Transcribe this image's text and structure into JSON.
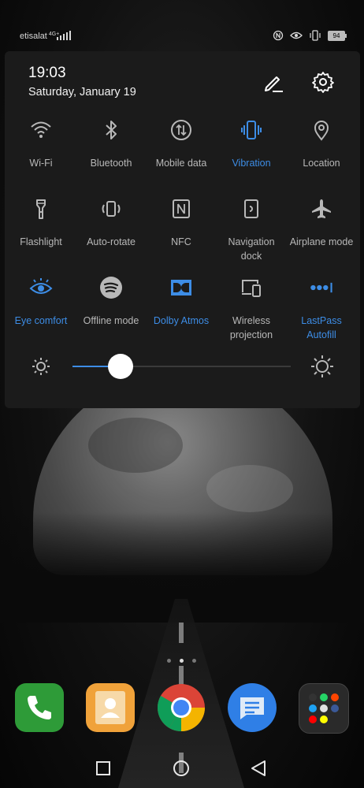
{
  "status_bar": {
    "carrier": "etisalat",
    "network_badge": "4G+",
    "battery": "94",
    "icons": [
      "nfc-icon",
      "eye-comfort-icon",
      "vibration-icon"
    ]
  },
  "panel": {
    "time": "19:03",
    "date": "Saturday, January 19",
    "edit_icon": "edit-pencil-icon",
    "settings_icon": "gear-icon",
    "tiles": [
      {
        "label": "Wi-Fi",
        "icon": "wifi-icon",
        "active": false
      },
      {
        "label": "Bluetooth",
        "icon": "bluetooth-icon",
        "active": false
      },
      {
        "label": "Mobile data",
        "icon": "mobile-data-icon",
        "active": false
      },
      {
        "label": "Vibration",
        "icon": "vibration-icon",
        "active": true
      },
      {
        "label": "Location",
        "icon": "location-pin-icon",
        "active": false
      },
      {
        "label": "Flashlight",
        "icon": "flashlight-icon",
        "active": false
      },
      {
        "label": "Auto-rotate",
        "icon": "auto-rotate-icon",
        "active": false
      },
      {
        "label": "NFC",
        "icon": "nfc-icon",
        "active": false
      },
      {
        "label": "Navigation dock",
        "icon": "navigation-dock-icon",
        "active": false
      },
      {
        "label": "Airplane mode",
        "icon": "airplane-icon",
        "active": false
      },
      {
        "label": "Eye comfort",
        "icon": "eye-icon",
        "active": true
      },
      {
        "label": "Offline mode",
        "icon": "spotify-icon",
        "active": false
      },
      {
        "label": "Dolby Atmos",
        "icon": "dolby-icon",
        "active": true
      },
      {
        "label": "Wireless projection",
        "icon": "wireless-projection-icon",
        "active": false
      },
      {
        "label": "LastPass Autofill",
        "icon": "lastpass-icon",
        "active": true
      }
    ],
    "brightness": {
      "level_percent": 22,
      "min_icon": "brightness-low-icon",
      "max_icon": "brightness-high-icon"
    }
  },
  "home": {
    "page_count": 3,
    "current_page": 2,
    "dock": [
      {
        "icon": "phone-icon",
        "color": "#2e9b38"
      },
      {
        "icon": "contacts-icon",
        "color": "#f0a23a"
      },
      {
        "icon": "chrome-icon",
        "color": "#ffffff"
      },
      {
        "icon": "messages-icon",
        "color": "#2f7fe6"
      },
      {
        "icon": "app-folder-icon",
        "color": "#2a2a2a"
      }
    ]
  },
  "navbar": {
    "buttons": [
      "recents-square-icon",
      "home-circle-icon",
      "back-triangle-icon"
    ]
  },
  "colors": {
    "accent": "#3d8de6",
    "panel": "#1b1b1b",
    "inactive_label": "#b8b8b8"
  }
}
